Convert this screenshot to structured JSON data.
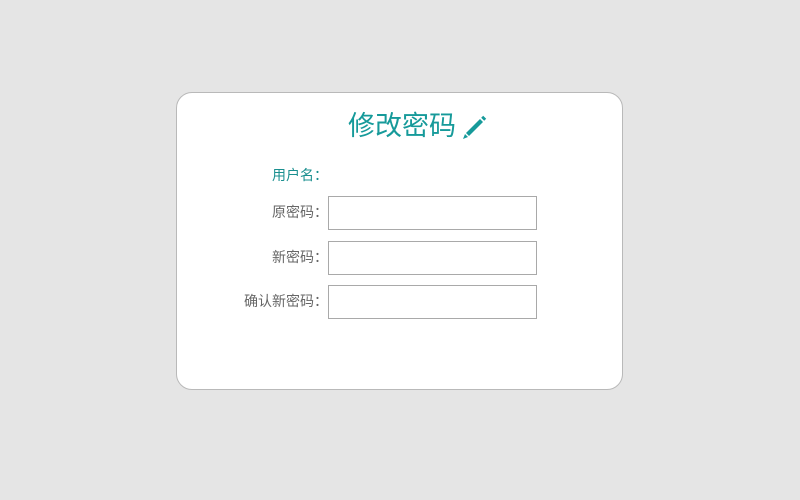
{
  "form": {
    "title": "修改密码",
    "title_icon": "pencil-icon",
    "accent_color": "#169a9a",
    "username_label": "用户名：",
    "username_value": "",
    "old_password_label": "原密码：",
    "old_password_value": "",
    "new_password_label": "新密码：",
    "new_password_value": "",
    "confirm_password_label": "确认新密码：",
    "confirm_password_value": ""
  }
}
